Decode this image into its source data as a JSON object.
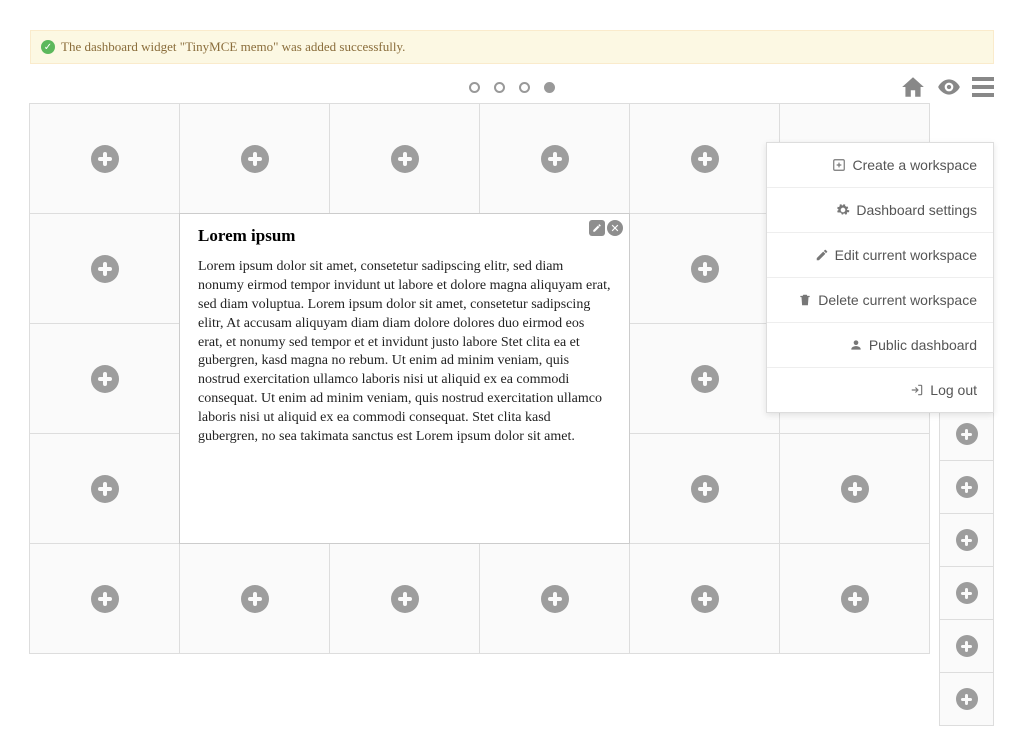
{
  "alert": {
    "text": "The dashboard widget \"TinyMCE memo\" was added successfully."
  },
  "pager": {
    "count": 4,
    "active_index": 3
  },
  "toolbar": {
    "home_icon": "home-icon",
    "eye_icon": "eye-icon",
    "menu_icon": "hamburger-icon"
  },
  "dropdown": {
    "items": [
      {
        "icon": "plus-square-icon",
        "label": "Create a workspace"
      },
      {
        "icon": "gear-icon",
        "label": "Dashboard settings"
      },
      {
        "icon": "edit-icon",
        "label": "Edit current workspace"
      },
      {
        "icon": "trash-icon",
        "label": "Delete current workspace"
      },
      {
        "icon": "person-icon",
        "label": "Public dashboard"
      },
      {
        "icon": "signout-icon",
        "label": "Log out"
      }
    ]
  },
  "widget": {
    "title": "Lorem ipsum",
    "body": "Lorem ipsum dolor sit amet, consetetur sadipscing elitr, sed diam nonumy eirmod tempor invidunt ut labore et dolore magna aliquyam erat, sed diam voluptua. Lorem ipsum dolor sit amet, consetetur sadipscing elitr, At accusam aliquyam diam diam dolore dolores duo eirmod eos erat, et nonumy sed tempor et et invidunt justo labore Stet clita ea et gubergren, kasd magna no rebum. Ut enim ad minim veniam, quis nostrud exercitation ullamco laboris nisi ut aliquid ex ea commodi consequat. Ut enim ad minim veniam, quis nostrud exercitation ullamco laboris nisi ut aliquid ex ea commodi consequat. Stet clita kasd gubergren, no sea takimata sanctus est Lorem ipsum dolor sit amet."
  },
  "grid": {
    "rows": 5,
    "cols": 6,
    "widget_span": {
      "row_start": 2,
      "col_start": 2,
      "row_span": 3,
      "col_span": 3
    }
  },
  "side_cells": 6
}
